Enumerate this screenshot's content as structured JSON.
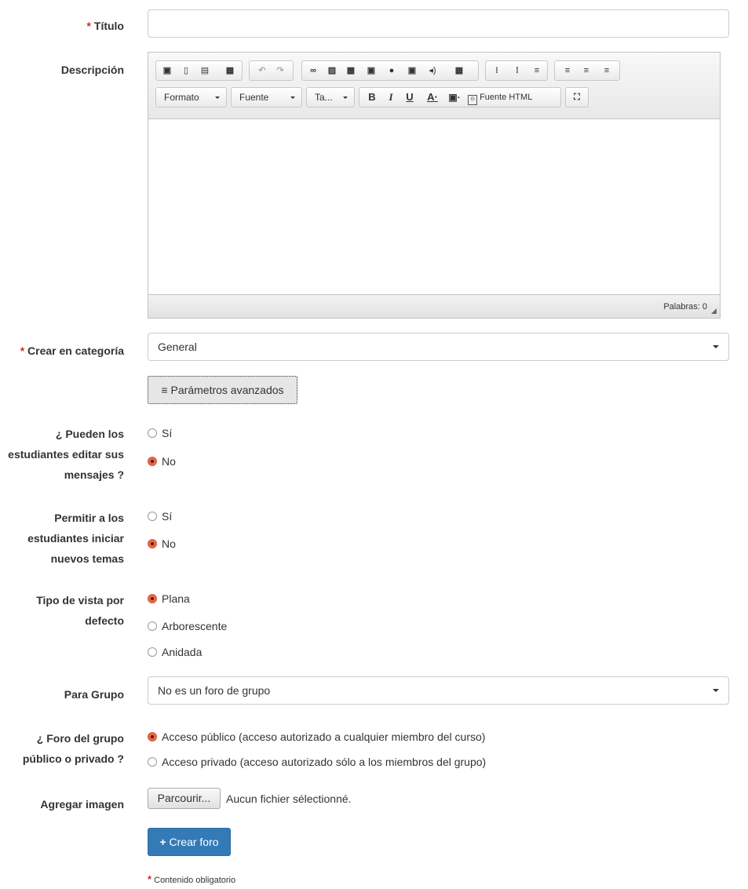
{
  "form": {
    "title_label": "Título",
    "description_label": "Descripción",
    "category_label": "Crear en categoría",
    "category_value": "General",
    "advanced_button": "Parámetros avanzados",
    "students_edit_label_line1": "¿ Pueden los",
    "students_edit_label_line2": "estudiantes editar sus",
    "students_edit_label_line3": "mensajes ?",
    "students_edit_options": [
      "Sí",
      "No"
    ],
    "new_topics_label_line1": "Permitir a los",
    "new_topics_label_line2": "estudiantes iniciar",
    "new_topics_label_line3": "nuevos temas",
    "new_topics_options": [
      "Sí",
      "No"
    ],
    "view_label_line1": "Tipo de vista por",
    "view_label_line2": "defecto",
    "view_options": [
      "Plana",
      "Arborescente",
      "Anidada"
    ],
    "group_label": "Para Grupo",
    "group_value": "No es un foro de grupo",
    "public_label_line1": "¿ Foro del grupo",
    "public_label_line2": "público o privado ?",
    "public_options": [
      "Acceso público (acceso autorizado a cualquier miembro del curso)",
      "Acceso privado (acceso autorizado sólo a los miembros del grupo)"
    ],
    "image_label": "Agregar imagen",
    "file_button": "Parcourir...",
    "file_status": "Aucun fichier sélectionné.",
    "submit_button": "Crear foro",
    "required_note": "Contenido obligatorio",
    "required_mark": "*"
  },
  "editor": {
    "format_combo": "Formato",
    "font_combo": "Fuente",
    "size_combo": "Ta...",
    "source_button": "Fuente HTML",
    "word_count": "Palabras: 0"
  },
  "colors": {
    "primary": "#337ab7",
    "required": "#c9302c",
    "radio_selected": "#e46a4c"
  }
}
